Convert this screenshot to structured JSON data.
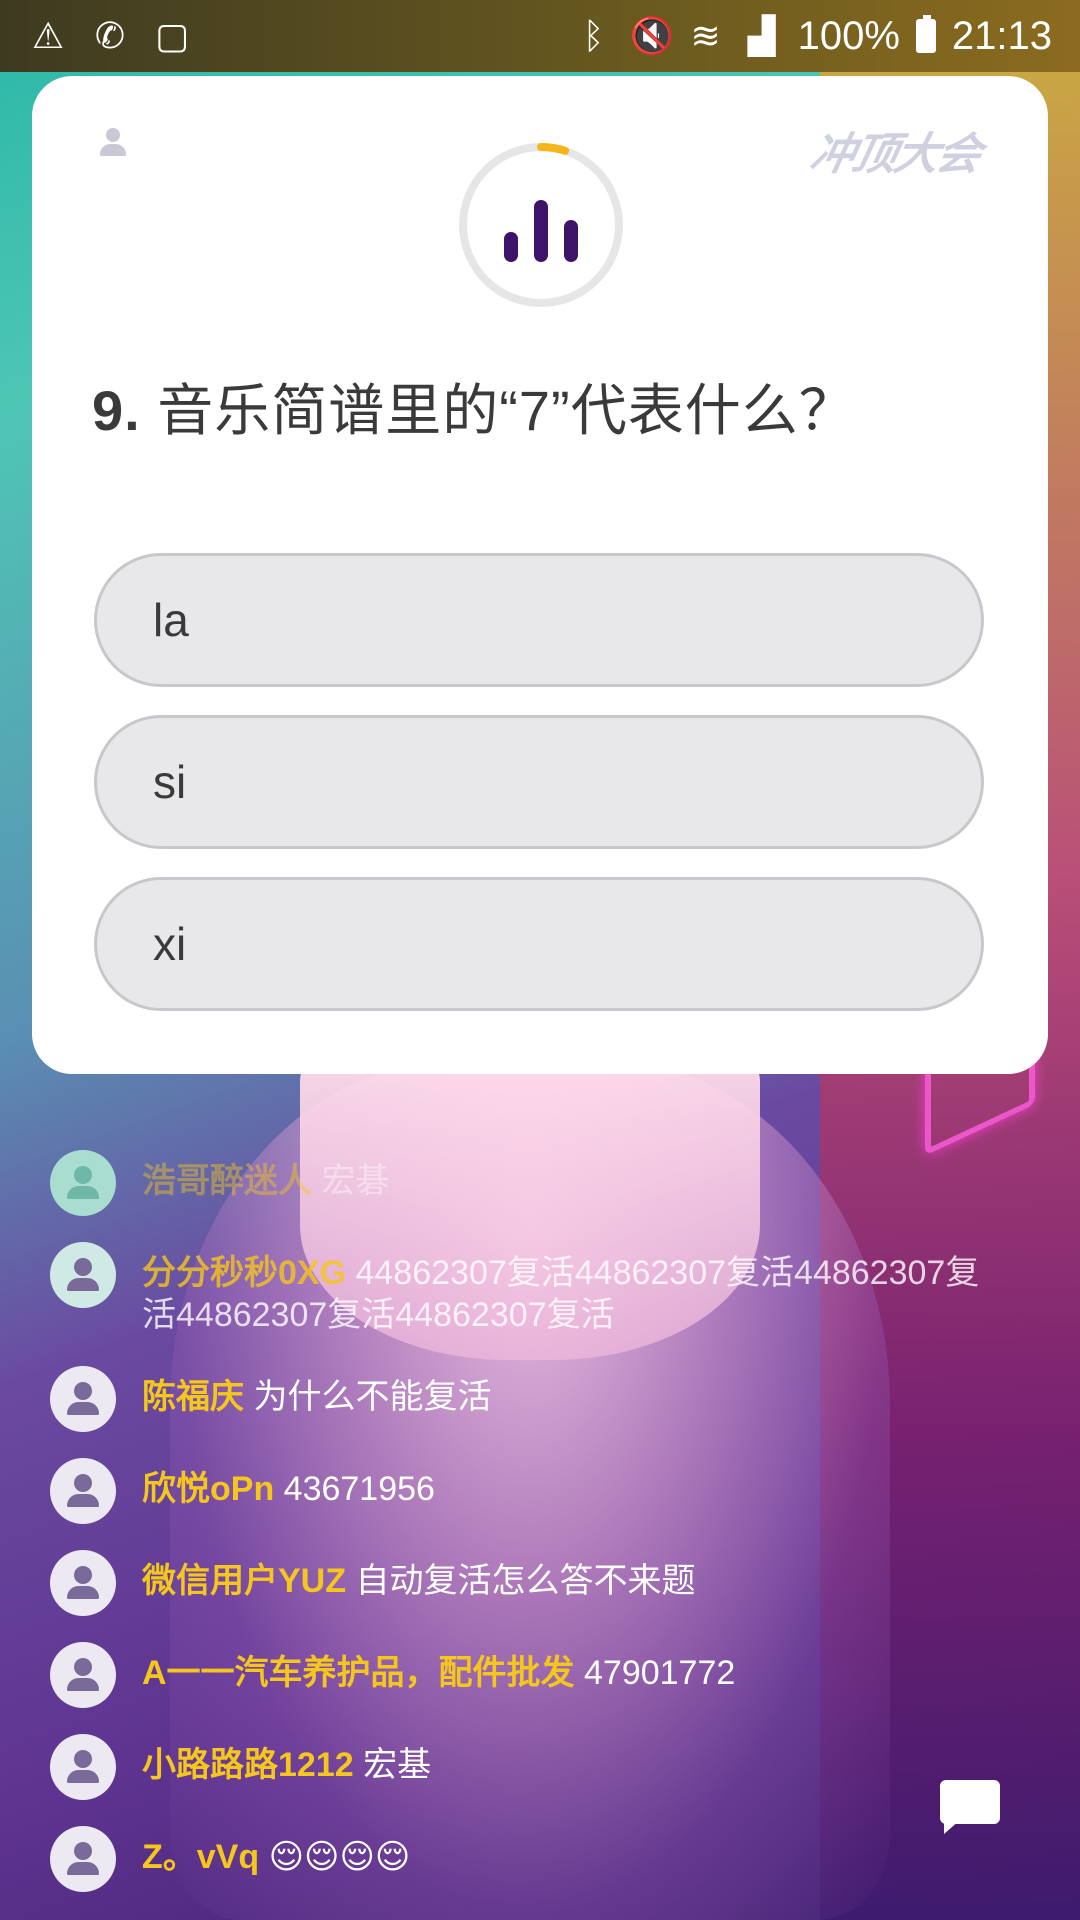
{
  "status_bar": {
    "left_icons": [
      "warning-icon",
      "wifi-call-icon",
      "screen-timer-icon"
    ],
    "right_icons": [
      "bluetooth-icon",
      "mute-icon",
      "wifi-icon",
      "signal-icon"
    ],
    "battery": "100%",
    "time": "21:13"
  },
  "card": {
    "logo": "冲顶大会",
    "question_number": "9.",
    "question_text": " 音乐简谱里的“7”代表什么？",
    "options": [
      "la",
      "si",
      "xi"
    ],
    "timer_progress": 0.05
  },
  "comments": [
    {
      "user": "浩哥醉迷人",
      "message": " 宏碁"
    },
    {
      "user": "分分秒秒0XG",
      "message": " 44862307复活44862307复活44862307复活44862307复活44862307复活"
    },
    {
      "user": "陈福庆",
      "message": " 为什么不能复活"
    },
    {
      "user": "欣悦oPn",
      "message": " 43671956"
    },
    {
      "user": "微信用户YUZ",
      "message": " 自动复活怎么答不来题"
    },
    {
      "user": "A一一汽车养护品，配件批发",
      "message": " 47901772"
    },
    {
      "user": "小路路路1212",
      "message": " 宏基"
    },
    {
      "user": "Z。vVq",
      "message": " 😌😌😌😌"
    }
  ],
  "colors": {
    "accent_yellow": "#f5c61c",
    "timer_arc": "#f5b51c",
    "icon_purple": "#3d1467"
  }
}
